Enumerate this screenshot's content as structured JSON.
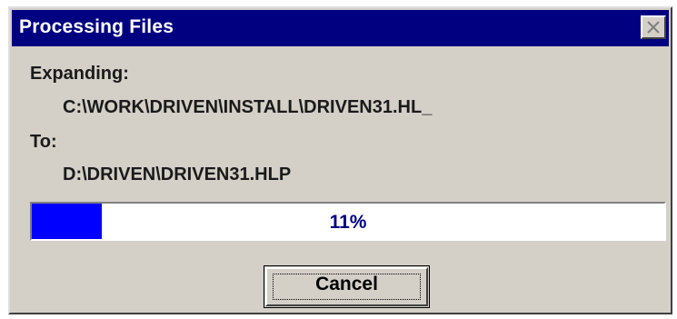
{
  "window": {
    "title": "Processing Files"
  },
  "operation": {
    "source_label": "Expanding:",
    "source_path": "C:\\WORK\\DRIVEN\\INSTALL\\DRIVEN31.HL_",
    "dest_label": "To:",
    "dest_path": "D:\\DRIVEN\\DRIVEN31.HLP"
  },
  "progress": {
    "percent": 11,
    "text": "11%",
    "fill_color": "#0000ff"
  },
  "buttons": {
    "cancel_label": "Cancel"
  },
  "icons": {
    "close": "close-icon"
  },
  "colors": {
    "titlebar": "#000080",
    "dialog_bg": "#d4d0c8",
    "progress_text": "#000080"
  }
}
